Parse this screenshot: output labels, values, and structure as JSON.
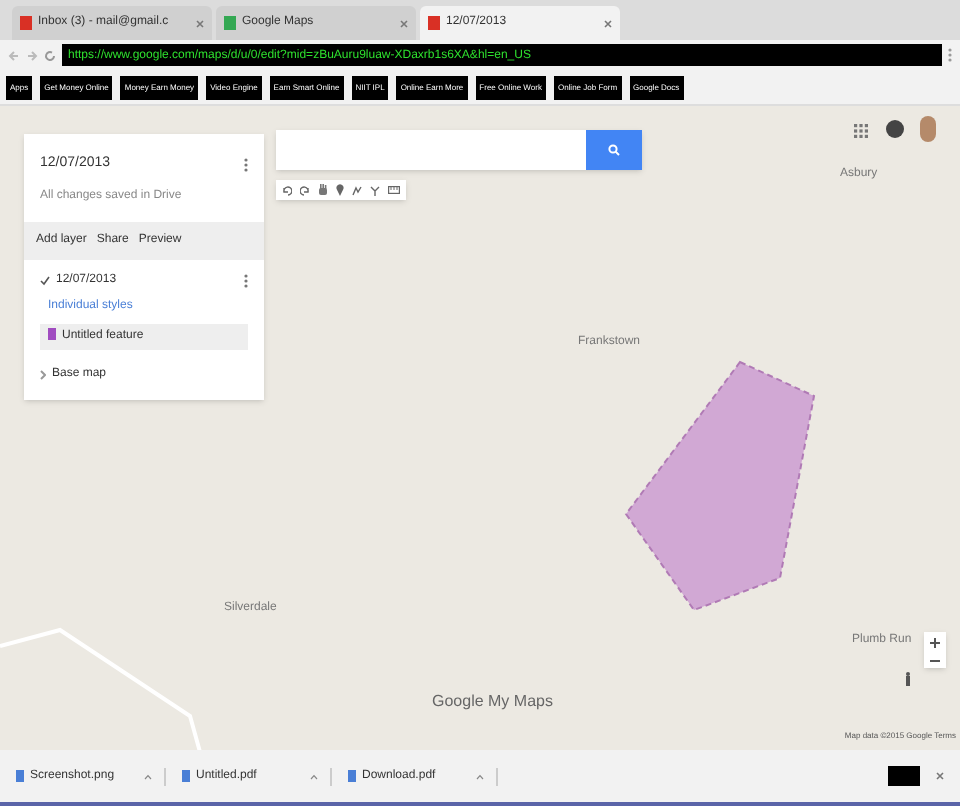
{
  "tabs": [
    {
      "title": "Inbox (3) - mail@gmail.c",
      "selected": false,
      "kind": "mail"
    },
    {
      "title": "Google Maps",
      "selected": false,
      "kind": "maps"
    },
    {
      "title": "12/07/2013",
      "selected": true,
      "kind": "mymaps"
    }
  ],
  "address": {
    "url": "https://www.google.com/maps/d/u/0/edit?mid=zBuAuru9luaw-XDaxrb1s6XA&hl=en_US"
  },
  "bookmarks": [
    {
      "label": "Apps"
    },
    {
      "label": "Get Money Online"
    },
    {
      "label": "Money Earn Money"
    },
    {
      "label": "Video Engine"
    },
    {
      "label": "Earn Smart Online"
    },
    {
      "label": "NIIT IPL"
    },
    {
      "label": "Online Earn More"
    },
    {
      "label": "Free Online Work"
    },
    {
      "label": "Online Job Form"
    },
    {
      "label": "Google Docs"
    }
  ],
  "map_panel": {
    "title": "12/07/2013",
    "subtitle": "All changes saved in Drive",
    "actions": [
      "Add layer",
      "Share",
      "Preview"
    ],
    "layer": {
      "title": "12/07/2013",
      "checked": true,
      "link": "Individual styles",
      "features": [
        {
          "label": "Untitled feature",
          "selected": true
        }
      ]
    },
    "base_map": "Base map"
  },
  "map_labels": [
    "Asbury",
    "Frankstown",
    "Silverdale",
    "Plumb Run"
  ],
  "branding": "Google My Maps",
  "attribution": "Map data ©2015 Google  Terms",
  "downloads": [
    {
      "name": "Screenshot.png"
    },
    {
      "name": "Untitled.pdf"
    },
    {
      "name": "Download.pdf"
    }
  ]
}
